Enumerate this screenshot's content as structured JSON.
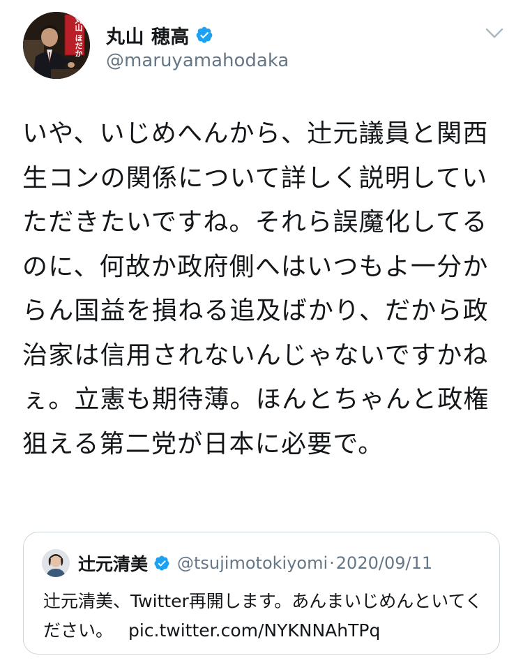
{
  "tweet": {
    "author": {
      "name": "丸山 穂高",
      "handle": "@maruyamahodaka",
      "verified": true,
      "avatar_text": "丸山 ほだか"
    },
    "text": "いや、いじめへんから、辻元議員と関西生コンの関係について詳しく説明していただきたいですね。それら誤魔化してるのに、何故か政府側へはいつもよ一分からん国益を損ねる追及ばかり、だから政治家は信用されないんじゃないですかねぇ。立憲も期待薄。ほんとちゃんと政権狙える第二党が日本に必要で。",
    "menu_icon": "chevron-down-icon"
  },
  "quote": {
    "author_name": "辻元清美",
    "handle": "@tsujimotokiyomi",
    "separator": "·",
    "date": "2020/09/11",
    "verified": true,
    "text": "辻元清美、Twitter再開します。あんまいじめんといてください。",
    "link": "pic.twitter.com/NYKNNAhTPq"
  },
  "colors": {
    "verified_blue": "#1da1f2",
    "secondary_text": "#657786",
    "border": "#ccd6dd"
  }
}
